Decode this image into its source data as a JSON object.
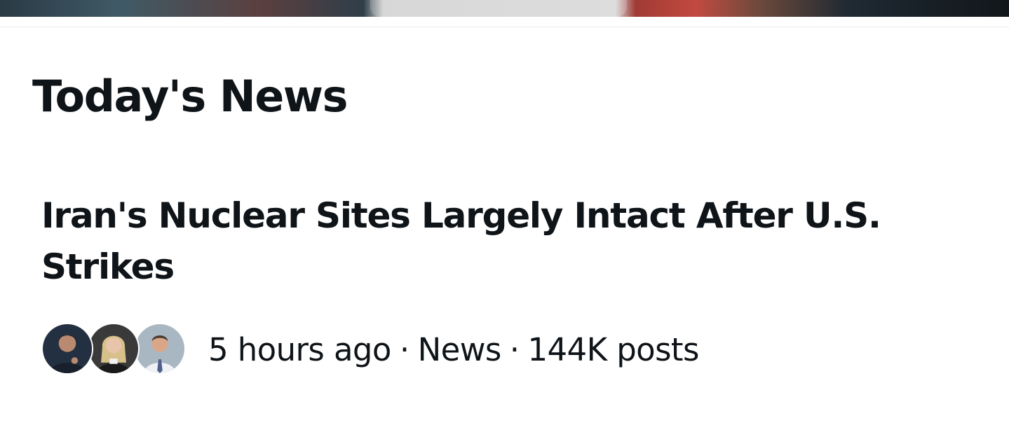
{
  "section": {
    "title": "Today's News"
  },
  "news_item": {
    "headline": "Iran's Nuclear Sites Largely Intact After U.S. Strikes",
    "time_ago": "5 hours ago",
    "separator": "·",
    "category": "News",
    "post_count": "144K posts",
    "avatars": [
      {
        "icon": "person-photo-avatar",
        "bg_color": "#223041"
      },
      {
        "icon": "person-photo-avatar",
        "bg_color": "#3b3a3a"
      },
      {
        "icon": "person-photo-avatar",
        "bg_color": "#a9b7c3"
      }
    ]
  },
  "colors": {
    "text_primary": "#0f1419",
    "divider": "#e6e9ec",
    "background": "#ffffff"
  }
}
